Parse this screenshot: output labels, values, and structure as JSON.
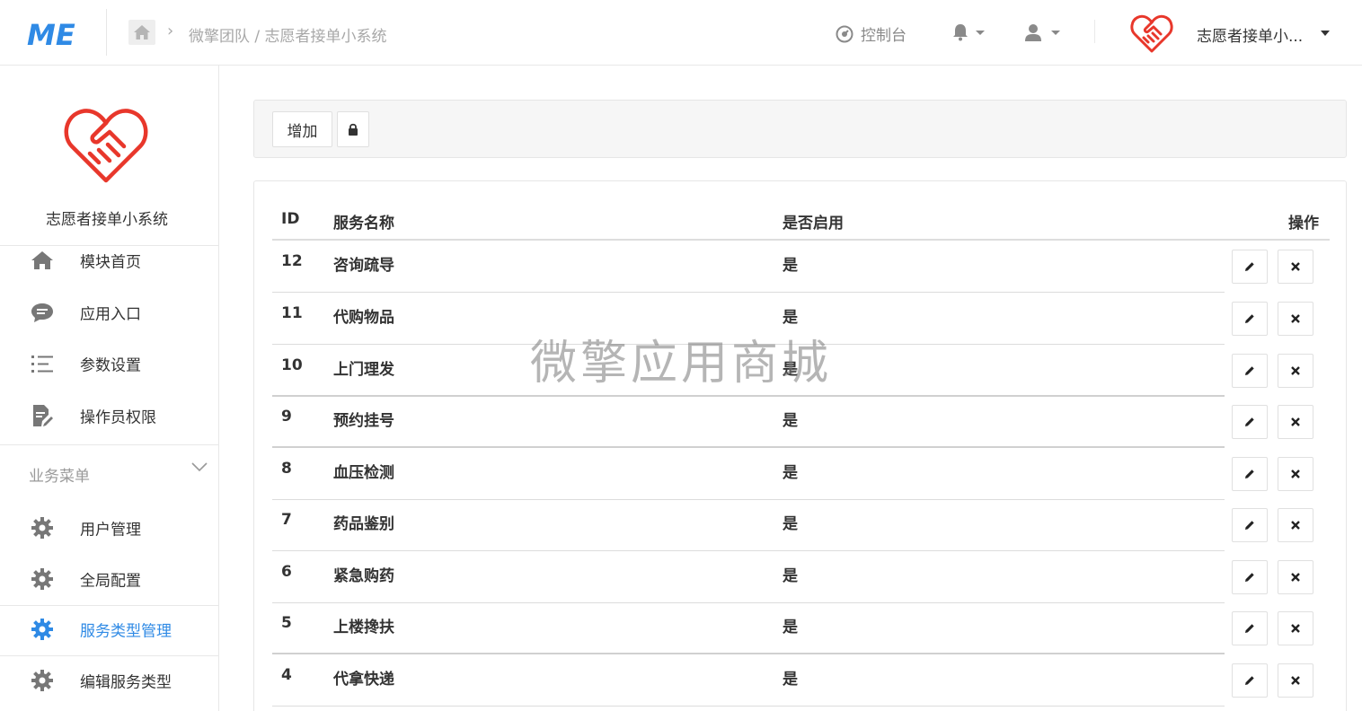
{
  "colors": {
    "brand_blue": "#2f8ae5",
    "heart_red": "#e8372b",
    "muted_text": "#a8a8a8",
    "border": "#e8e8e8"
  },
  "header": {
    "logo_icon": "me-logo-icon",
    "breadcrumb": "微擎团队 / 志愿者接单小系统",
    "console_label": "控制台",
    "brand_name": "志愿者接单小..."
  },
  "sidebar": {
    "system_name": "志愿者接单小系统",
    "items": [
      {
        "label": "模块首页",
        "icon": "home-icon"
      },
      {
        "label": "应用入口",
        "icon": "chat-icon"
      },
      {
        "label": "参数设置",
        "icon": "list-icon"
      },
      {
        "label": "操作员权限",
        "icon": "edit-doc-icon"
      }
    ],
    "section_title": "业务菜单",
    "business_items": [
      {
        "label": "用户管理",
        "icon": "gear-icon"
      },
      {
        "label": "全局配置",
        "icon": "gear-icon"
      },
      {
        "label": "服务类型管理",
        "icon": "gear-icon",
        "active": true
      },
      {
        "label": "编辑服务类型",
        "icon": "gear-icon"
      }
    ]
  },
  "toolbar": {
    "add_label": "增加"
  },
  "table": {
    "headers": {
      "id": "ID",
      "name": "服务名称",
      "enabled": "是否启用",
      "actions": "操作"
    },
    "rows": [
      {
        "id": "12",
        "name": "咨询疏导",
        "enabled": "是"
      },
      {
        "id": "11",
        "name": "代购物品",
        "enabled": "是"
      },
      {
        "id": "10",
        "name": "上门理发",
        "enabled": "是"
      },
      {
        "id": "9",
        "name": "预约挂号",
        "enabled": "是"
      },
      {
        "id": "8",
        "name": "血压检测",
        "enabled": "是"
      },
      {
        "id": "7",
        "name": "药品鉴别",
        "enabled": "是"
      },
      {
        "id": "6",
        "name": "紧急购药",
        "enabled": "是"
      },
      {
        "id": "5",
        "name": "上楼搀扶",
        "enabled": "是"
      },
      {
        "id": "4",
        "name": "代拿快递",
        "enabled": "是"
      }
    ]
  },
  "watermark": "微擎应用商城"
}
